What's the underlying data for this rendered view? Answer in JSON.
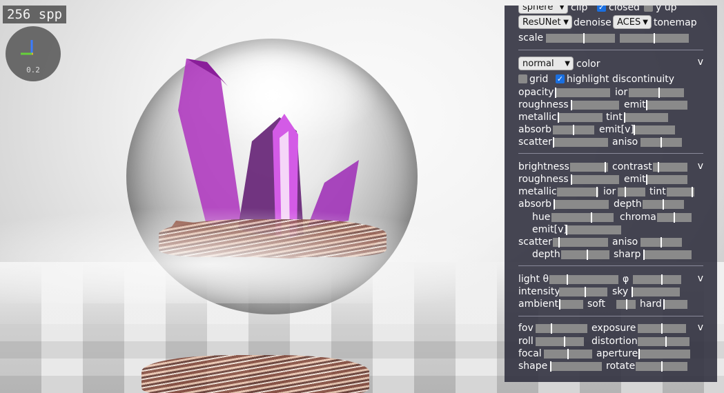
{
  "viewport": {
    "spp_label": "256 spp",
    "gizmo_value": "0.2"
  },
  "panel": {
    "top": {
      "shape_select": "sphere",
      "clip_label": "clip",
      "closed_label": "closed",
      "closed_checked": true,
      "yup_label": "y up",
      "yup_checked": false,
      "denoiser_select": "ResUNet",
      "denoise_label": "denoise",
      "tonemap_select": "ACES",
      "tonemap_label": "tonemap",
      "scale_label": "scale",
      "scale_values": [
        0.55,
        0.5
      ]
    },
    "material": {
      "color_select": "normal",
      "color_label": "color",
      "grid_label": "grid",
      "grid_checked": false,
      "highlight_label": "highlight discontinuity",
      "highlight_checked": true,
      "collapse": "v",
      "opacity": {
        "label": "opacity",
        "value": 0.0
      },
      "ior": {
        "label": "ior",
        "value": 0.55
      },
      "roughness": {
        "label": "roughness",
        "value": 0.0
      },
      "emit": {
        "label": "emit",
        "value": 0.0
      },
      "metallic": {
        "label": "metallic",
        "value": 0.0
      },
      "tint": {
        "label": "tint",
        "value": 0.0
      },
      "absorb": {
        "label": "absorb",
        "value": 0.5
      },
      "emit_v": {
        "label": "emit[v]",
        "value": 0.0
      },
      "scatter": {
        "label": "scatter",
        "value": 0.0
      },
      "aniso": {
        "label": "aniso",
        "value": 0.5
      }
    },
    "adjust": {
      "collapse": "v",
      "brightness": {
        "label": "brightness",
        "value": 0.95
      },
      "contrast": {
        "label": "contrast",
        "value": 0.15
      },
      "roughness": {
        "label": "roughness",
        "value": 0.0
      },
      "emit": {
        "label": "emit",
        "value": 0.0
      },
      "metallic": {
        "label": "metallic",
        "value": 0.98
      },
      "ior": {
        "label": "ior",
        "value": 0.25
      },
      "tint": {
        "label": "tint",
        "value": 0.95
      },
      "absorb": {
        "label": "absorb",
        "value": 0.0
      },
      "depth": {
        "label": "depth",
        "value": 0.5
      },
      "hue": {
        "label": "hue",
        "value": 0.65
      },
      "chroma": {
        "label": "chroma",
        "value": 0.5
      },
      "emit_v": {
        "label": "emit[v]",
        "value": 0.0
      },
      "scatter": {
        "label": "scatter",
        "value": 0.1
      },
      "aniso": {
        "label": "aniso",
        "value": 0.5
      },
      "depth2": {
        "label": "depth",
        "value": 0.55
      },
      "sharp": {
        "label": "sharp",
        "value": 0.0
      }
    },
    "light": {
      "collapse": "v",
      "theta": {
        "label": "light θ",
        "value": 0.25
      },
      "phi": {
        "label": "φ",
        "value": 0.6
      },
      "intensity": {
        "label": "intensity",
        "value": 0.55
      },
      "sky": {
        "label": "sky",
        "value": 0.0
      },
      "ambient": {
        "label": "ambient",
        "value": 0.0
      },
      "soft": {
        "label": "soft",
        "value": 0.55
      },
      "hard": {
        "label": "hard",
        "value": 0.0
      }
    },
    "camera": {
      "collapse": "v",
      "fov": {
        "label": "fov",
        "value": 0.3
      },
      "exposure": {
        "label": "exposure",
        "value": 0.5
      },
      "roll": {
        "label": "roll",
        "value": 0.6
      },
      "distortion": {
        "label": "distortion",
        "value": 0.55
      },
      "focal": {
        "label": "focal",
        "value": 0.5
      },
      "aperture": {
        "label": "aperture",
        "value": 0.0
      },
      "shape": {
        "label": "shape",
        "value": 0.0
      },
      "rotate": {
        "label": "rotate",
        "value": 0.5
      }
    }
  }
}
